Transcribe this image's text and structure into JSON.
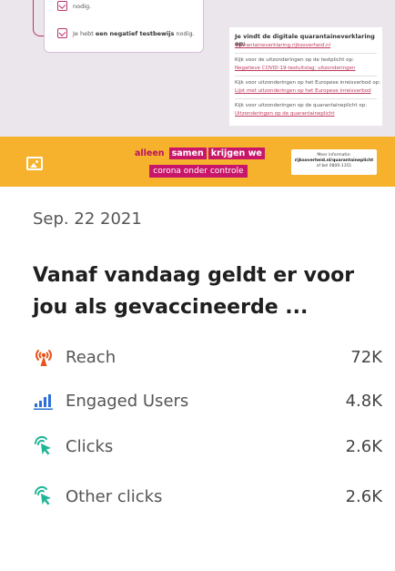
{
  "creative": {
    "left_card": {
      "row1_text": "nodig.",
      "row2_prefix": "Je hebt ",
      "row2_bold": "een negatief testbewijs",
      "row2_suffix": " nodig."
    },
    "right_card": {
      "title": "Je vindt de digitale quarantaineverklaring op:",
      "link1": "quarantaineverklaring.rijksoverheid.nl",
      "line2": "Kijk voor de uitzonderingen op de testplicht op:",
      "link2": "Negatieve COVID-19-testuitslag: uitzonderingen",
      "line3": "Kijk voor uitzonderingen op het Europese inreisverbod op:",
      "link3": "Lijst met uitzonderingen op het Europese inreisverbod",
      "line4": "Kijk voor uitzonderingen op de quarantaineplicht op:",
      "link4": "Uitzonderingen op de quarantaineplicht"
    },
    "slogan": {
      "w1": "alleen",
      "w2": "samen",
      "w3": "krijgen we",
      "w4": "corona onder controle"
    },
    "info_box": {
      "line1": "Meer informatie:",
      "line2": "rijksoverheid.nl/quarantaineplicht",
      "line3": "of bel 0800-1351"
    }
  },
  "post": {
    "date": "Sep. 22 2021",
    "headline": "Vanaf vandaag geldt er voor jou als gevaccineerde ..."
  },
  "metrics": [
    {
      "label": "Reach",
      "value": "72K",
      "icon": "reach-antenna-icon"
    },
    {
      "label": "Engaged Users",
      "value": "4.8K",
      "icon": "bar-chart-icon"
    },
    {
      "label": "Clicks",
      "value": "2.6K",
      "icon": "cursor-click-icon"
    },
    {
      "label": "Other clicks",
      "value": "2.6K",
      "icon": "cursor-click-icon"
    }
  ],
  "colors": {
    "banner": "#f6b12d",
    "magenta": "#c8176a",
    "reach_icon": "#e8531c",
    "engaged_icon": "#2b6fd6",
    "click_icon": "#1fb597"
  }
}
